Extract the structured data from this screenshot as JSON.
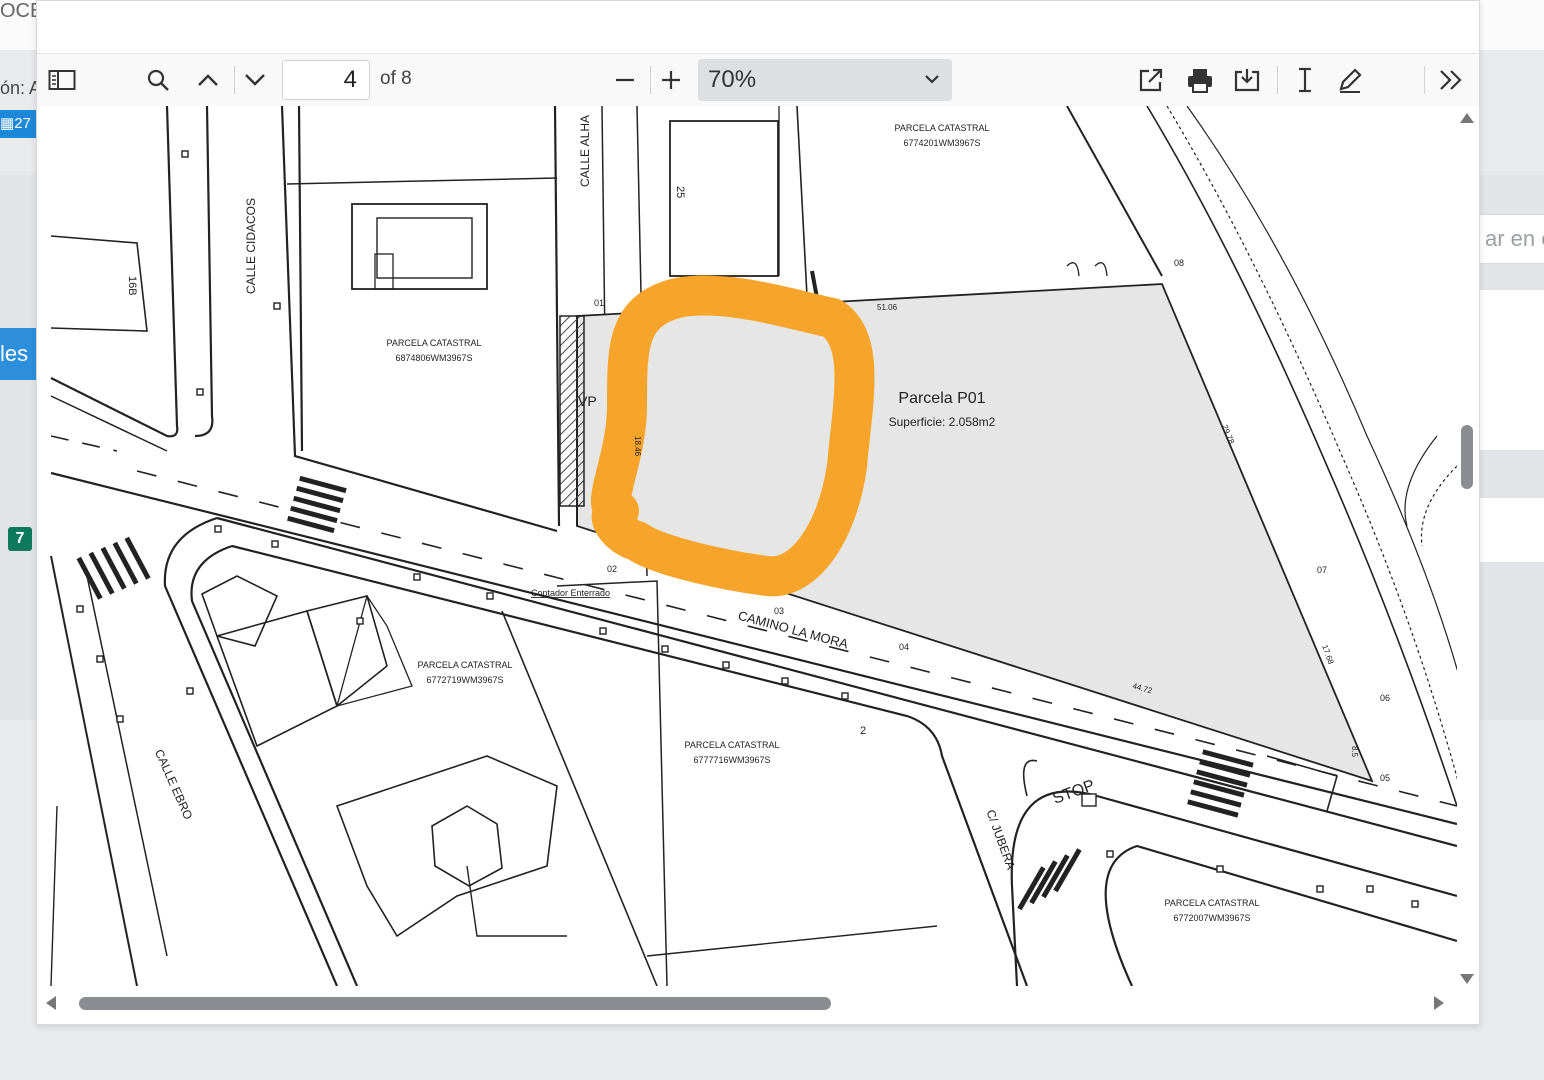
{
  "background": {
    "doc_label_fragment": "OCE",
    "left_label_fragment": "ón: A",
    "date_chip_fragment": "27",
    "tab_fragment": "les",
    "badge_count": "7",
    "search_fragment": "ar en c"
  },
  "toolbar": {
    "page_current": "4",
    "page_total": "of 8",
    "zoom_value": "70%"
  },
  "icons": {
    "sidebar": "sidebar-toggle-icon",
    "search": "search-icon",
    "prev": "chevron-up-icon",
    "next": "chevron-down-icon",
    "zoom_out": "minus-icon",
    "zoom_in": "plus-icon",
    "open": "external-link-icon",
    "print": "printer-icon",
    "save": "download-icon",
    "text": "text-cursor-icon",
    "draw": "pen-icon",
    "more": "double-chevron-right-icon"
  },
  "plan": {
    "streets": {
      "cidacos": "CALLE CIDACOS",
      "alhama": "CALLE ALHA",
      "mora": "CAMINO LA MORA",
      "ebro": "CALLE EBRO",
      "jubera": "C/ JUBERA"
    },
    "parcels": {
      "p_top_label": "PARCELA CATASTRAL",
      "p_top_ref": "6774201WM3967S",
      "p_left_label": "PARCELA CATASTRAL",
      "p_left_ref": "6874806WM3967S",
      "p_mid1_label": "PARCELA CATASTRAL",
      "p_mid1_ref": "6772719WM3967S",
      "p_mid2_label": "PARCELA CATASTRAL",
      "p_mid2_ref": "6777716WM3967S",
      "p_br_label": "PARCELA CATASTRAL",
      "p_br_ref": "6772007WM3967S"
    },
    "main_parcel_title": "Parcela P01",
    "main_parcel_area": "Superficie: 2.058m2",
    "stop": "STOP",
    "vp": "VP",
    "contador": "Contador Enterrado",
    "building_num_1": "16B",
    "building_num_2": "25",
    "points": [
      "01",
      "02",
      "03",
      "04",
      "05",
      "06",
      "07",
      "08"
    ],
    "dimensions": [
      "51.06",
      "18.46",
      "29.78",
      "17.68",
      "44.72",
      "8.5"
    ],
    "street_mark": "2"
  },
  "colors": {
    "highlight": "#f7a52a",
    "parcel_fill": "#e6e6e6",
    "toolbar_bg": "#f9f9fa"
  }
}
